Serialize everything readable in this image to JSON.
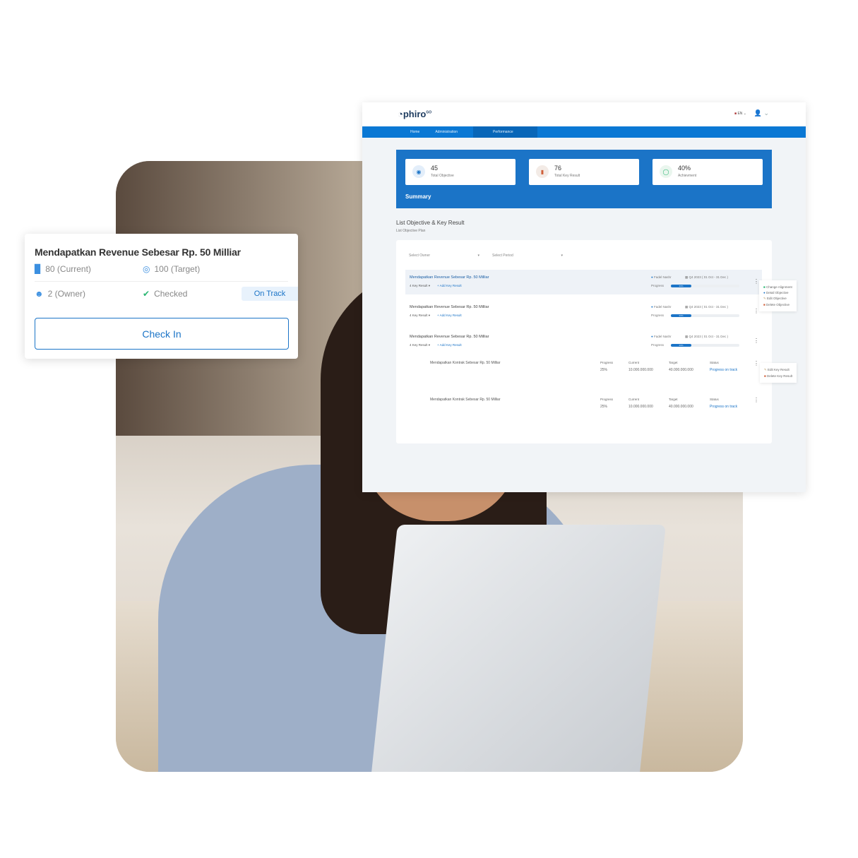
{
  "dashboard": {
    "logo": "phiro",
    "logo_sup": "GO",
    "language": "EN",
    "nav": [
      "Home",
      "Administration",
      "Performance"
    ],
    "stats": [
      {
        "value": "45",
        "label": "Total Objective",
        "icon": "target-icon"
      },
      {
        "value": "76",
        "label": "Total Key Result",
        "icon": "bar-chart-icon"
      },
      {
        "value": "40%",
        "label": "Achievment",
        "icon": "progress-ring-icon"
      }
    ],
    "summary_title": "Summary",
    "list_title": "List Objective & Key Result",
    "list_subtitle": "List Objective Plan",
    "select_owner": "Select Owner",
    "select_period": "Select Period",
    "objectives": [
      {
        "title": "Mendapatkan Revenue Sebesar Rp. 50 Milliar",
        "key_results": "4 Key Result",
        "add": "+ Add Key Result",
        "owner": "Fadel Nashr",
        "period": "Q4 2023 ( 01 Oct - 31 Dec )",
        "progress_label": "Progress",
        "progress": 30
      },
      {
        "title": "Mendapatkan Revenue Sebesar Rp. 50 Milliar",
        "key_results": "4 Key Result",
        "add": "+ Add Key Result",
        "owner": "Fadel Nashr",
        "period": "Q4 2023 ( 01 Oct - 31 Dec )",
        "progress_label": "Progress",
        "progress": 30
      },
      {
        "title": "Mendapatkan Revenue Sebesar Rp. 50 Milliar",
        "key_results": "4 Key Result",
        "add": "+ Add Key Result",
        "owner": "Fadel Nashr",
        "period": "Q4 2023 ( 01 Oct - 31 Dec )",
        "progress_label": "Progress",
        "progress": 30
      }
    ],
    "key_results": [
      {
        "title": "Mendapatkan Kontrak Sebesar Rp. 50 Milliar",
        "progress_h": "Progress",
        "progress": "25%",
        "current_h": "Current",
        "current": "10.000.000.000",
        "target_h": "Target",
        "target": "40.000.000.000",
        "status_h": "Status",
        "status": "Progress on track"
      },
      {
        "title": "Mendapatkan Kontrak Sebesar Rp. 50 Milliar",
        "progress_h": "Progress",
        "progress": "25%",
        "current_h": "Current",
        "current": "10.000.000.000",
        "target_h": "Target",
        "target": "40.000.000.000",
        "status_h": "Status",
        "status": "Progress on track"
      }
    ],
    "objective_menu": [
      "Change Alignment",
      "Detail Objective",
      "Edit Objective",
      "Delete Objective"
    ],
    "kr_menu": [
      "Edit Key Result",
      "Delete Key Result"
    ]
  },
  "card": {
    "title": "Mendapatkan Revenue Sebesar Rp. 50 Milliar",
    "current": "80 (Current)",
    "target": "100 (Target)",
    "owner": "2 (Owner)",
    "checked": "Checked",
    "status": "On Track",
    "button": "Check In"
  },
  "colors": {
    "primary": "#0a78d4",
    "success": "#2bb673"
  }
}
